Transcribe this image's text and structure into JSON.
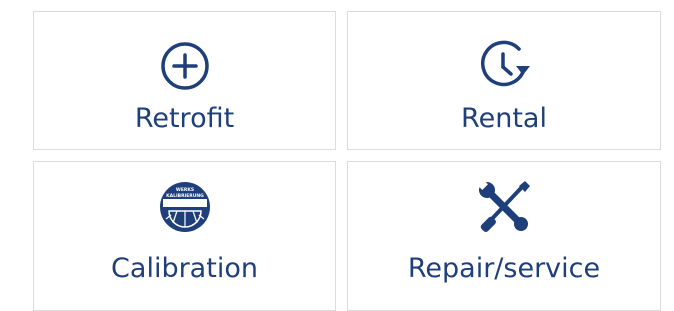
{
  "tiles": [
    {
      "label": "Retrofit",
      "icon": "plus-circle-icon"
    },
    {
      "label": "Rental",
      "icon": "clock-arrow-icon"
    },
    {
      "label": "Calibration",
      "icon": "calibration-seal-icon",
      "seal_text": [
        "WERKS",
        "KALIBRIERUNG"
      ]
    },
    {
      "label": "Repair/service",
      "icon": "tools-icon"
    }
  ],
  "colors": {
    "accent": "#1f3f7a",
    "border": "#dcdcdc",
    "background": "#ffffff"
  }
}
